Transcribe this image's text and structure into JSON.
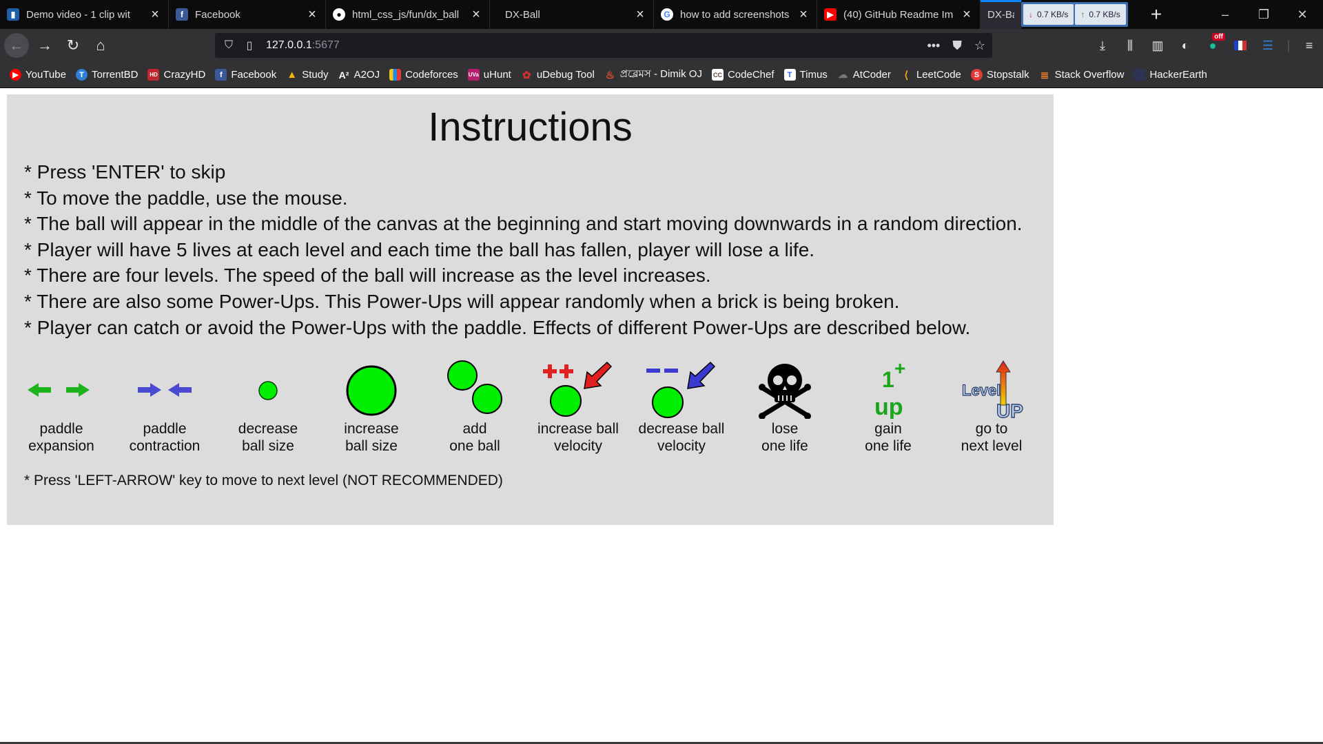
{
  "tabs": [
    {
      "title": "Demo video - 1 clip wit",
      "icon": "clip-app-icon",
      "color": "#4a90d9"
    },
    {
      "title": "Facebook",
      "icon": "facebook-icon",
      "color": "#3b5998"
    },
    {
      "title": "html_css_js/fun/dx_ball",
      "icon": "github-icon",
      "color": "#ffffff"
    },
    {
      "title": "DX-Ball",
      "icon": "none",
      "color": ""
    },
    {
      "title": "how to add screenshots",
      "icon": "google-icon",
      "color": "#ffffff"
    },
    {
      "title": "(40) GitHub Readme Im",
      "icon": "youtube-icon",
      "color": "#ff0000"
    },
    {
      "title": "DX-Bal",
      "icon": "none",
      "color": ""
    }
  ],
  "speed": {
    "down": "0.7 KB/s",
    "up": "0.7 KB/s"
  },
  "url": {
    "host": "127.0.0.1",
    "port": ":5677"
  },
  "extension_badge": "off",
  "bookmarks": [
    {
      "label": "YouTube",
      "icon": "youtube-icon",
      "color": "#ff0000"
    },
    {
      "label": "TorrentBD",
      "icon": "torrentbd-icon",
      "color": "#2f7fd6"
    },
    {
      "label": "CrazyHD",
      "icon": "crazyhd-icon",
      "color": "#c0272d"
    },
    {
      "label": "Facebook",
      "icon": "facebook-icon",
      "color": "#3b5998"
    },
    {
      "label": "Study",
      "icon": "google-drive-icon",
      "color": "#1fa463"
    },
    {
      "label": "A2OJ",
      "icon": "a2oj-icon",
      "color": "#444444"
    },
    {
      "label": "Codeforces",
      "icon": "codeforces-icon",
      "color": "#f5c518"
    },
    {
      "label": "uHunt",
      "icon": "uva-icon",
      "color": "#b71c6e"
    },
    {
      "label": "uDebug Tool",
      "icon": "udebug-icon",
      "color": "#d32f2f"
    },
    {
      "label": "প্রব্লেমস - Dimik OJ",
      "icon": "dimik-icon",
      "color": "#e8502a"
    },
    {
      "label": "CodeChef",
      "icon": "codechef-icon",
      "color": "#5b4638"
    },
    {
      "label": "Timus",
      "icon": "timus-icon",
      "color": "#2962ff"
    },
    {
      "label": "AtCoder",
      "icon": "atcoder-icon",
      "color": "#555555"
    },
    {
      "label": "LeetCode",
      "icon": "leetcode-icon",
      "color": "#f89f1b"
    },
    {
      "label": "Stopstalk",
      "icon": "stopstalk-icon",
      "color": "#e53935"
    },
    {
      "label": "Stack Overflow",
      "icon": "stackoverflow-icon",
      "color": "#f48024"
    },
    {
      "label": "HackerEarth",
      "icon": "hackerearth-icon",
      "color": "#2c3454"
    }
  ],
  "instructions": {
    "title": "Instructions",
    "lines": [
      "* Press 'ENTER' to skip",
      "* To move the paddle, use the mouse.",
      "* The ball will appear in the middle of the canvas at the beginning and start moving downwards in a random direction.",
      "* Player will have 5 lives at each level and each time the ball has fallen, player will lose a life.",
      "* There are four levels. The speed of the ball will increase as the level increases.",
      "* There are also some Power-Ups. This Power-Ups will appear randomly when a brick is being broken.",
      "* Player can catch or avoid the Power-Ups with the paddle. Effects of different Power-Ups are described below."
    ],
    "powerups": [
      {
        "line1": "paddle",
        "line2": "expansion",
        "icon": "paddle-expansion-icon"
      },
      {
        "line1": "paddle",
        "line2": "contraction",
        "icon": "paddle-contraction-icon"
      },
      {
        "line1": "decrease",
        "line2": "ball size",
        "icon": "small-ball-icon"
      },
      {
        "line1": "increase",
        "line2": "ball size",
        "icon": "big-ball-icon"
      },
      {
        "line1": "add",
        "line2": "one ball",
        "icon": "two-balls-icon"
      },
      {
        "line1": "increase ball",
        "line2": "velocity",
        "icon": "speed-up-icon"
      },
      {
        "line1": "decrease ball",
        "line2": "velocity",
        "icon": "speed-down-icon"
      },
      {
        "line1": "lose",
        "line2": "one life",
        "icon": "skull-icon"
      },
      {
        "line1": "gain",
        "line2": "one life",
        "icon": "one-up-icon"
      },
      {
        "line1": "go to",
        "line2": "next level",
        "icon": "level-up-icon"
      }
    ],
    "powerup_icon_text": {
      "one_up_1": "1",
      "one_up_plus": "+",
      "one_up_word": "up",
      "level_word": "Level",
      "up_word": "UP",
      "plus_plus": "++",
      "minus_minus": "--"
    },
    "footnote": "* Press 'LEFT-ARROW' key to move to next level (NOT RECOMMENDED)"
  },
  "colors": {
    "ball": "#00ee00",
    "panel": "#dcdcdc",
    "accent": "#0a84ff"
  }
}
